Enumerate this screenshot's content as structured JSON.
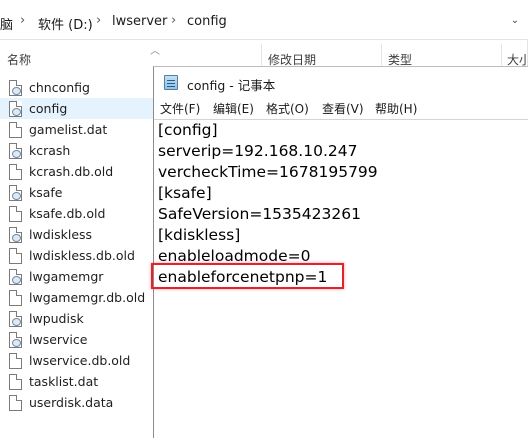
{
  "address_bar": {
    "crumbs": [
      "脑",
      "软件 (D:)",
      "lwserver",
      "config"
    ],
    "separator": "›"
  },
  "columns": {
    "name": "名称",
    "modified": "修改日期",
    "type": "类型",
    "size": "大小"
  },
  "files": [
    {
      "name": "chnconfig",
      "icon": "config-file-icon",
      "selected": false
    },
    {
      "name": "config",
      "icon": "config-file-icon",
      "selected": true
    },
    {
      "name": "gamelist.dat",
      "icon": "file-icon",
      "selected": false
    },
    {
      "name": "kcrash",
      "icon": "config-file-icon",
      "selected": false
    },
    {
      "name": "kcrash.db.old",
      "icon": "file-icon",
      "selected": false
    },
    {
      "name": "ksafe",
      "icon": "config-file-icon",
      "selected": false
    },
    {
      "name": "ksafe.db.old",
      "icon": "file-icon",
      "selected": false
    },
    {
      "name": "lwdiskless",
      "icon": "config-file-icon",
      "selected": false
    },
    {
      "name": "lwdiskless.db.old",
      "icon": "file-icon",
      "selected": false
    },
    {
      "name": "lwgamemgr",
      "icon": "config-file-icon",
      "selected": false
    },
    {
      "name": "lwgamemgr.db.old",
      "icon": "file-icon",
      "selected": false
    },
    {
      "name": "lwpudisk",
      "icon": "config-file-icon",
      "selected": false
    },
    {
      "name": "lwservice",
      "icon": "config-file-icon",
      "selected": false
    },
    {
      "name": "lwservice.db.old",
      "icon": "file-icon",
      "selected": false
    },
    {
      "name": "tasklist.dat",
      "icon": "file-icon",
      "selected": false
    },
    {
      "name": "userdisk.data",
      "icon": "file-icon",
      "selected": false
    }
  ],
  "notepad": {
    "title": "config - 记事本",
    "menus": [
      "文件(F)",
      "编辑(E)",
      "格式(O)",
      "查看(V)",
      "帮助(H)"
    ],
    "lines": [
      "[config]",
      "serverip=192.168.10.247",
      "vercheckTime=1678195799",
      "[ksafe]",
      "SafeVersion=1535423261",
      "[kdiskless]",
      "enableloadmode=0",
      "enableforcenetpnp=1"
    ],
    "highlighted_line_index": 7,
    "highlight_color": "#e4222e"
  }
}
